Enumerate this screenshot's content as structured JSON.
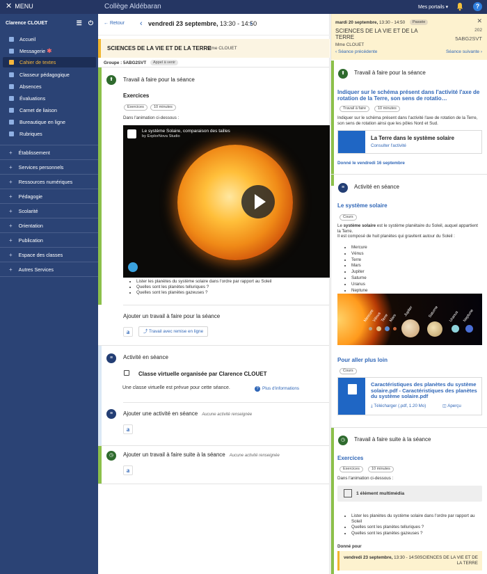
{
  "topbar": {
    "menu_label": "MENU",
    "college": "Collège Aldébaran",
    "portails": "Mes portails",
    "help": "?"
  },
  "sidebar": {
    "user": "Clarence CLOUET",
    "items": [
      {
        "label": "Accueil"
      },
      {
        "label": "Messagerie"
      },
      {
        "label": "Cahier de textes"
      },
      {
        "label": "Classeur pédagogique"
      },
      {
        "label": "Absences"
      },
      {
        "label": "Évaluations"
      },
      {
        "label": "Carnet de liaison"
      },
      {
        "label": "Bureautique en ligne"
      },
      {
        "label": "Rubriques"
      }
    ],
    "sections": [
      {
        "label": "Établissement"
      },
      {
        "label": "Services personnels"
      },
      {
        "label": "Ressources numériques"
      },
      {
        "label": "Pédagogie"
      },
      {
        "label": "Scolarité"
      },
      {
        "label": "Orientation"
      },
      {
        "label": "Publication"
      },
      {
        "label": "Espace des classes"
      },
      {
        "label": "Autres Services"
      }
    ]
  },
  "middle": {
    "retour": "Retour",
    "date_day": "vendredi 23 septembre,",
    "date_time": " 13:30 - 14:50",
    "subject": "SCIENCES DE LA VIE ET DE LA TERRE",
    "teacher": "Mme CLOUET",
    "groupe": "Groupe : 5ABG2SVT",
    "appel": "Appel à venir",
    "travail_title": "Travail à faire pour la séance",
    "exercices": "Exercices",
    "chip_exercices": "Exercices",
    "chip_duration": "10 minutes",
    "intro": "Dans l'animation ci-dessous :",
    "video_title": "Le système Solaire, comparaison des tailles",
    "video_sub": "by ExplorNova Studio",
    "bullets": [
      "Lister les planètes du système solaire dans l'ordre par rapport au Soleil",
      "Quelles sont les planètes telluriques ?",
      "Quelles sont les planètes gazeuses ?"
    ],
    "ajouter_travail": "Ajouter un travail à faire pour la séance",
    "remise_btn": "Travail avec remise en ligne",
    "activite_title": "Activité en séance",
    "cv_title": "Classe virtuelle organisée par Clarence CLOUET",
    "cv_desc": "Une classe virtuelle est prévue pour cette séance.",
    "cv_info": "Plus d'informations",
    "ajouter_activite": "Ajouter une activité en séance",
    "aucune_activite": "Aucune activité renseignée",
    "ajouter_suite": "Ajouter un travail à faire suite à la séance",
    "aucune_activite2": "Aucune activité renseignée"
  },
  "right": {
    "date_day": "mardi 20 septembre,",
    "date_time": " 13:30 - 14:50",
    "passee": "Passée",
    "subject": "SCIENCES DE LA VIE ET DE LA TERRE",
    "room": "202",
    "group": "5ABG2SVT",
    "teacher": "Mme CLOUET",
    "prev": "Séance précédente",
    "next": "Séance suivante",
    "travail_title": "Travail à faire pour la séance",
    "travail_link": "Indiquer sur le schéma présent dans l'activité l'axe de rotation de la Terre, son sens de rotatio…",
    "chip_travail": "Travail à faire",
    "chip_duration": "10 minutes",
    "travail_desc": "Indiquer sur le schéma présent dans l'activité l'axe de rotation de la Terre, son sens de rotation ainsi que les pôles Nord et Sud.",
    "card_title": "La Terre dans le système solaire",
    "card_sub": "Consulter l'activité",
    "donne": "Donné le vendredi 16 septembre",
    "activite_title": "Activité en séance",
    "systeme_link": "Le système solaire",
    "chip_cours": "Cours",
    "sys_text_1": "Le ",
    "sys_text_bold": "système solaire",
    "sys_text_2": " est le système planétaire du Soleil, auquel appartient la Terre.",
    "sys_text_3": "Il est composé de huit planètes qui gravitent autour du Soleil :",
    "planets": [
      "Mercure",
      "Vénus",
      "Terre",
      "Mars",
      "Jupiter",
      "Saturne",
      "Uranus",
      "Neptune"
    ],
    "plus_loin": "Pour aller plus loin",
    "chip_cours2": "Cours",
    "pdf_title": "Caractéristiques des planètes du système solaire.pdf - Caractéristiques des planètes du système solaire.pdf",
    "pdf_dl": "Télécharger (.pdf, 1.20 Mo)",
    "pdf_ap": "Aperçu",
    "suite_title": "Travail à faire suite à la séance",
    "exercices": "Exercices",
    "chip_exercices": "Exercices",
    "chip_duration2": "10 minutes",
    "intro": "Dans l'animation ci-dessous :",
    "media": "1 élément multimédia",
    "bullets": [
      "Lister les planètes du système solaire dans l'ordre par rapport au Soleil",
      "Quelles sont les planètes telluriques ?",
      "Quelles sont les planètes gazeuses ?"
    ],
    "donne_pour": "Donné pour",
    "donne_card_day": "vendredi 23 septembre,",
    "donne_card_time": " 13:30 - 14:50",
    "donne_card_subject": "SCIENCES DE LA VIE ET DE LA TERRE"
  },
  "colors": {
    "topbar": "#253663",
    "sidebar": "#2b4375",
    "accent_green": "#8cc04a",
    "accent_gold": "#f0b52d",
    "link_blue": "#2f66b7"
  }
}
